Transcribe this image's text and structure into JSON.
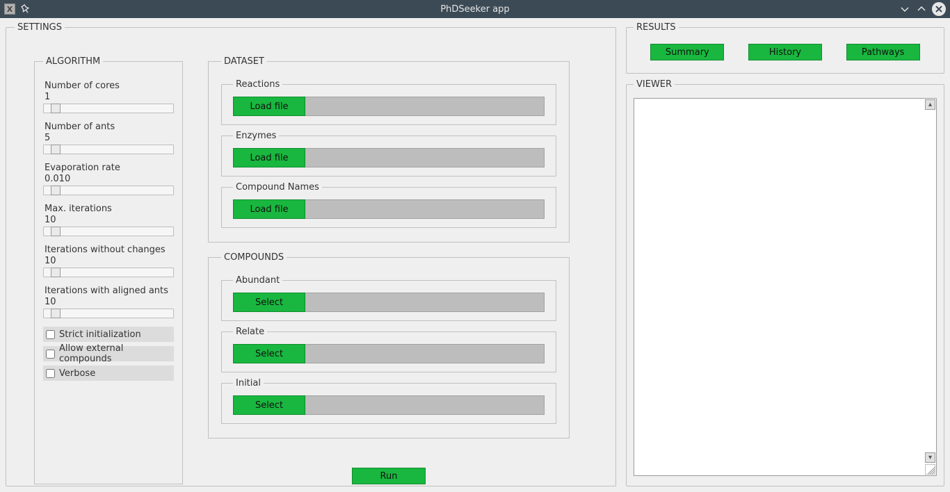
{
  "window": {
    "title": "PhDSeeker app"
  },
  "settings": {
    "legend": "SETTINGS",
    "algorithm": {
      "legend": "ALGORITHM",
      "items": [
        {
          "label": "Number of cores",
          "value": "1"
        },
        {
          "label": "Number of ants",
          "value": "5"
        },
        {
          "label": "Evaporation rate",
          "value": "0.010"
        },
        {
          "label": "Max. iterations",
          "value": "10"
        },
        {
          "label": "Iterations without changes",
          "value": "10"
        },
        {
          "label": "Iterations with aligned ants",
          "value": "10"
        }
      ],
      "checks": [
        {
          "label": "Strict initialization",
          "checked": false
        },
        {
          "label": "Allow external compounds",
          "checked": false
        },
        {
          "label": "Verbose",
          "checked": false
        }
      ]
    },
    "dataset": {
      "legend": "DATASET",
      "groups": [
        {
          "legend": "Reactions",
          "button": "Load file"
        },
        {
          "legend": "Enzymes",
          "button": "Load file"
        },
        {
          "legend": "Compound Names",
          "button": "Load file"
        }
      ]
    },
    "compounds": {
      "legend": "COMPOUNDS",
      "groups": [
        {
          "legend": "Abundant",
          "button": "Select"
        },
        {
          "legend": "Relate",
          "button": "Select"
        },
        {
          "legend": "Initial",
          "button": "Select"
        }
      ]
    },
    "run_label": "Run"
  },
  "results": {
    "legend": "RESULTS",
    "buttons": [
      {
        "label": "Summary"
      },
      {
        "label": "History"
      },
      {
        "label": "Pathways"
      }
    ]
  },
  "viewer": {
    "legend": "VIEWER"
  }
}
